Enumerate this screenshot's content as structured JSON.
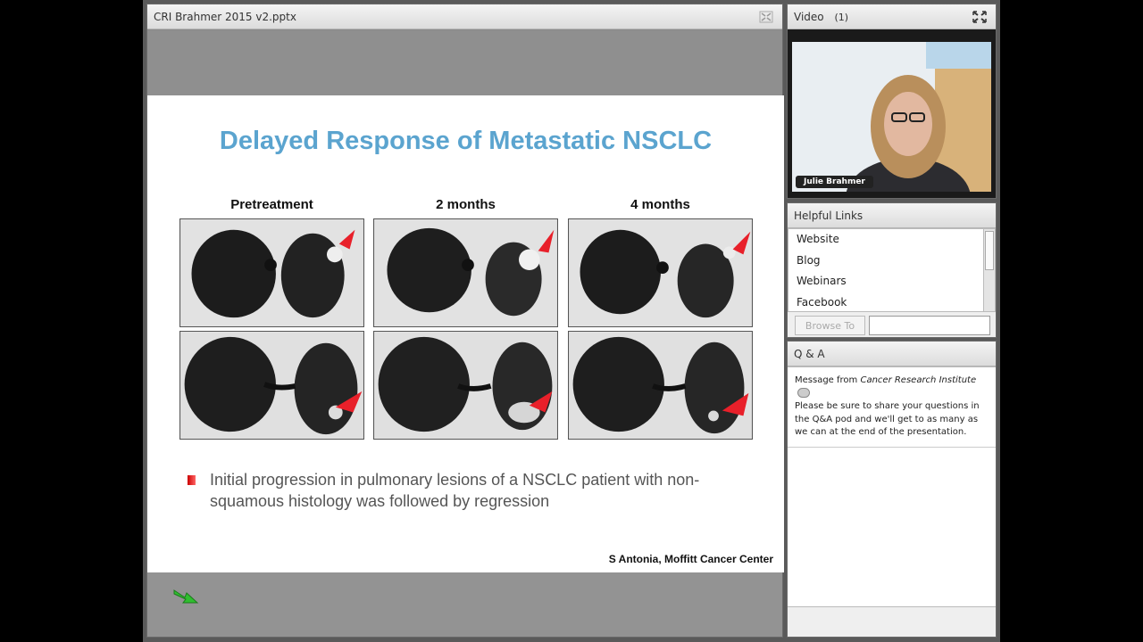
{
  "share_pod": {
    "title": "CRI Brahmer 2015 v2.pptx",
    "fullscreen_icon": "expand-arrows-icon"
  },
  "slide": {
    "title": "Delayed Response of Metastatic NSCLC",
    "columns": [
      "Pretreatment",
      "2 months",
      "4 months"
    ],
    "bullet": "Initial progression in pulmonary lesions of a NSCLC patient with non-squamous histology was followed by regression",
    "credit": "S Antonia, Moffitt Cancer Center",
    "arrow_color": "#e8202a",
    "title_color": "#5ba4cf"
  },
  "video_pod": {
    "title": "Video",
    "count": "(1)",
    "presenter": "Julie Brahmer",
    "fullscreen_icon": "expand-arrows-icon"
  },
  "links_pod": {
    "title": "Helpful Links",
    "items": [
      "Website",
      "Blog",
      "Webinars",
      "Facebook"
    ],
    "browse_label": "Browse To"
  },
  "qa_pod": {
    "title": "Q & A",
    "message_prefix": "Message from",
    "sender": "Cancer Research Institute",
    "message": "Please be sure to share your questions in the Q&A pod and we'll get to as many as we can at the end of the presentation."
  }
}
